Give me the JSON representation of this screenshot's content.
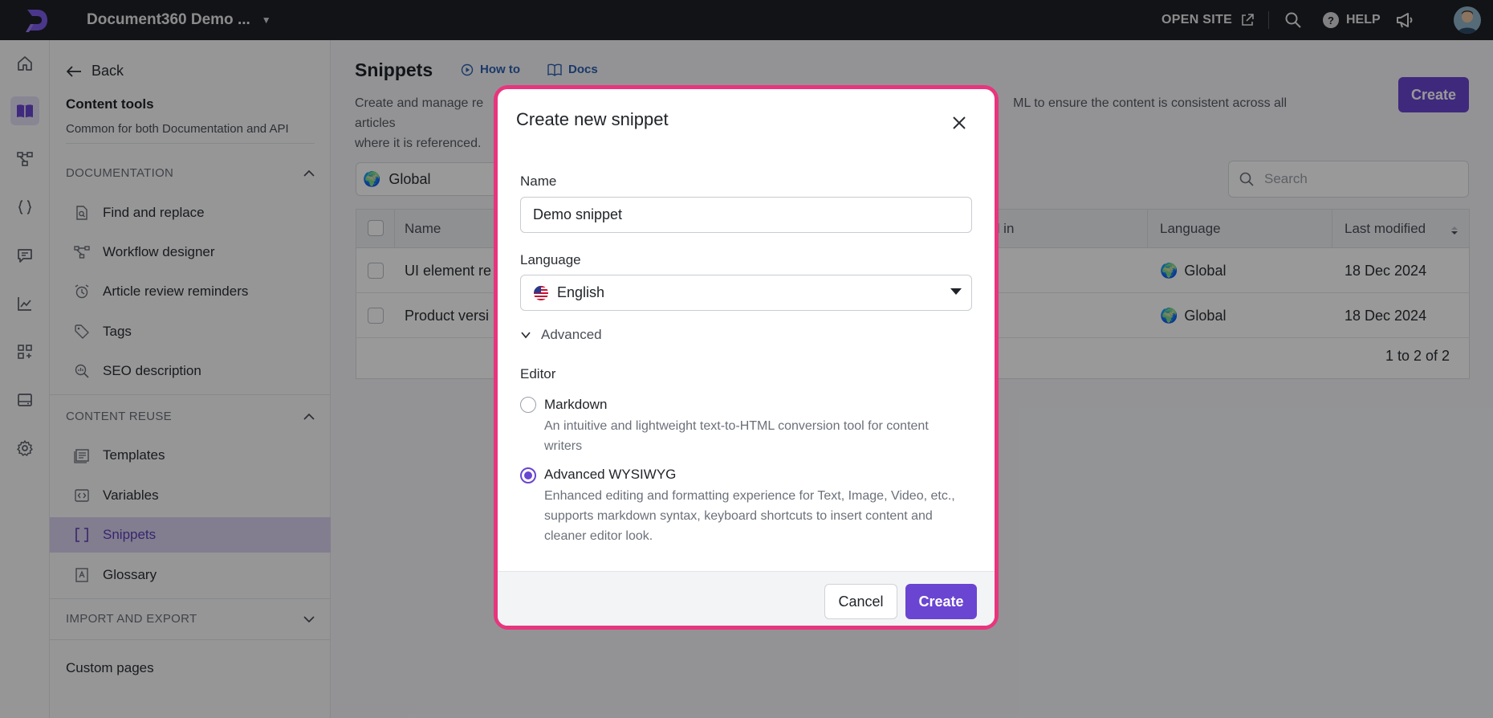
{
  "topbar": {
    "project_name": "Document360 Demo ...",
    "open_site": "OPEN SITE",
    "help": "HELP"
  },
  "sidebar": {
    "back": "Back",
    "title": "Content tools",
    "subtitle": "Common for both Documentation and API",
    "sections": {
      "documentation": "DOCUMENTATION",
      "content_reuse": "CONTENT REUSE",
      "import_export": "IMPORT AND EXPORT"
    },
    "doc_items": [
      {
        "label": "Find and replace"
      },
      {
        "label": "Workflow designer"
      },
      {
        "label": "Article review reminders"
      },
      {
        "label": "Tags"
      },
      {
        "label": "SEO description"
      }
    ],
    "reuse_items": [
      {
        "label": "Templates"
      },
      {
        "label": "Variables"
      },
      {
        "label": "Snippets"
      },
      {
        "label": "Glossary"
      }
    ],
    "custom_pages": "Custom pages"
  },
  "main": {
    "title": "Snippets",
    "how_to": "How to",
    "docs": "Docs",
    "description_left": "Create and manage re",
    "description_right": "ML to ensure the content is consistent across all articles",
    "description_line2": "where it is referenced.",
    "create": "Create",
    "filter_value": "Global",
    "search_placeholder": "Search",
    "columns": {
      "name": "Name",
      "used_in": "d in",
      "language": "Language",
      "last_modified": "Last modified"
    },
    "rows": [
      {
        "name": "UI element re",
        "language": "Global",
        "modified": "18 Dec 2024"
      },
      {
        "name": "Product versi",
        "language": "Global",
        "modified": "18 Dec 2024"
      }
    ],
    "pager": "1 to 2 of 2"
  },
  "modal": {
    "title": "Create new snippet",
    "name_label": "Name",
    "name_value": "Demo snippet",
    "language_label": "Language",
    "language_value": "English",
    "advanced": "Advanced",
    "editor_label": "Editor",
    "options": [
      {
        "title": "Markdown",
        "desc": "An intuitive and lightweight text-to-HTML conversion tool for content writers",
        "selected": false
      },
      {
        "title": "Advanced WYSIWYG",
        "desc": "Enhanced editing and formatting experience for Text, Image, Video, etc., supports markdown syntax, keyboard shortcuts to insert content and cleaner editor look.",
        "selected": true
      }
    ],
    "cancel": "Cancel",
    "create": "Create"
  },
  "colors": {
    "accent": "#6a45d1",
    "highlight_ring": "#e8357d",
    "topbar": "#1f2025"
  }
}
